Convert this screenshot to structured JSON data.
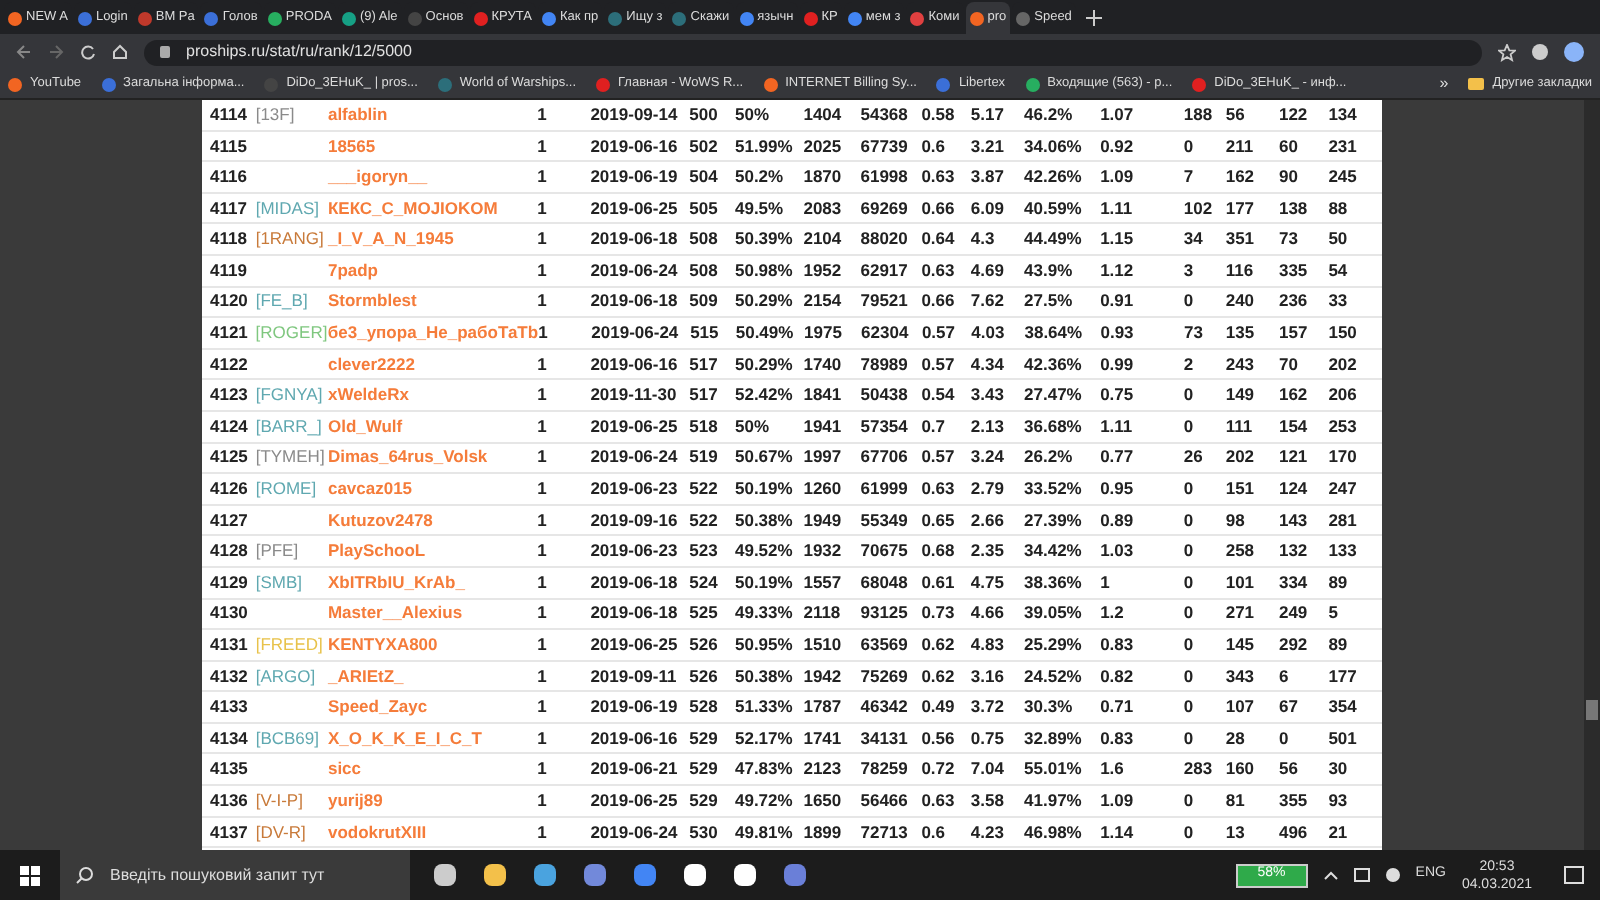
{
  "tabs": [
    {
      "title": "NEW A",
      "selected": false
    },
    {
      "title": "Login",
      "selected": false
    },
    {
      "title": "BM Pa",
      "selected": false
    },
    {
      "title": "Голов",
      "selected": false
    },
    {
      "title": "PRODA",
      "selected": false
    },
    {
      "title": "(9) Ale",
      "selected": false
    },
    {
      "title": "Основ",
      "selected": false
    },
    {
      "title": "КРУТА",
      "selected": false
    },
    {
      "title": "Как пр",
      "selected": false
    },
    {
      "title": "Ищу з",
      "selected": false
    },
    {
      "title": "Скажи",
      "selected": false
    },
    {
      "title": "язычн",
      "selected": false
    },
    {
      "title": "КР",
      "selected": false
    },
    {
      "title": "мем з",
      "selected": false
    },
    {
      "title": "Коми",
      "selected": false
    },
    {
      "title": "pro",
      "selected": true
    },
    {
      "title": "Speed",
      "selected": false
    }
  ],
  "address_bar": {
    "url": "proships.ru/stat/ru/rank/12/5000"
  },
  "bookmarks": [
    "YouTube",
    "Загальна інформа...",
    "DiDo_3EHuK_ | pros...",
    "World of Warships...",
    "Главная - WoWS R...",
    "INTERNET Billing Sy...",
    "Libertex",
    "Входящие (563) - p...",
    "DiDo_3EHuK_ - инф..."
  ],
  "bookmarks_overflow": "»",
  "other_bookmarks": "Другие закладки",
  "table": {
    "rows": [
      {
        "rank": "4114",
        "clan": "[13F]",
        "color": "#8a8a8a",
        "name": "alfablin",
        "cells": [
          "1",
          "2019-09-14",
          "500",
          "50%",
          "1404",
          "54368",
          "0.58",
          "5.17",
          "46.2%",
          "1.07",
          "188",
          "56",
          "122",
          "134"
        ]
      },
      {
        "rank": "4115",
        "name": "18565",
        "cells": [
          "1",
          "2019-06-16",
          "502",
          "51.99%",
          "2025",
          "67739",
          "0.6",
          "3.21",
          "34.06%",
          "0.92",
          "0",
          "211",
          "60",
          "231"
        ]
      },
      {
        "rank": "4116",
        "name": "___igoryn__",
        "cells": [
          "1",
          "2019-06-19",
          "504",
          "50.2%",
          "1870",
          "61998",
          "0.63",
          "3.87",
          "42.26%",
          "1.09",
          "7",
          "162",
          "90",
          "245"
        ]
      },
      {
        "rank": "4117",
        "clan": "[MIDAS]",
        "color": "#5fa8b0",
        "name": "КЕКС_С_MOJIOKOM",
        "cells": [
          "1",
          "2019-06-25",
          "505",
          "49.5%",
          "2083",
          "69269",
          "0.66",
          "6.09",
          "40.59%",
          "1.11",
          "102",
          "177",
          "138",
          "88"
        ]
      },
      {
        "rank": "4118",
        "clan": "[1RANG]",
        "color": "#c87a3a",
        "name": "_I_V_A_N_1945",
        "cells": [
          "1",
          "2019-06-18",
          "508",
          "50.39%",
          "2104",
          "88020",
          "0.64",
          "4.3",
          "44.49%",
          "1.15",
          "34",
          "351",
          "73",
          "50"
        ]
      },
      {
        "rank": "4119",
        "name": "7padp",
        "cells": [
          "1",
          "2019-06-24",
          "508",
          "50.98%",
          "1952",
          "62917",
          "0.63",
          "4.69",
          "43.9%",
          "1.12",
          "3",
          "116",
          "335",
          "54"
        ]
      },
      {
        "rank": "4120",
        "clan": "[FE_B]",
        "color": "#5fa8b0",
        "name": "Stormblest",
        "cells": [
          "1",
          "2019-06-18",
          "509",
          "50.29%",
          "2154",
          "79521",
          "0.66",
          "7.62",
          "27.5%",
          "0.91",
          "0",
          "240",
          "236",
          "33"
        ]
      },
      {
        "rank": "4121",
        "clan": "[ROGER]",
        "color": "#7fc77f",
        "name": "бе3_упора_Не_рабоТаТb",
        "cells": [
          "1",
          "2019-06-24",
          "515",
          "50.49%",
          "1975",
          "62304",
          "0.57",
          "4.03",
          "38.64%",
          "0.93",
          "73",
          "135",
          "157",
          "150"
        ]
      },
      {
        "rank": "4122",
        "name": "clever2222",
        "cells": [
          "1",
          "2019-06-16",
          "517",
          "50.29%",
          "1740",
          "78989",
          "0.57",
          "4.34",
          "42.36%",
          "0.99",
          "2",
          "243",
          "70",
          "202"
        ]
      },
      {
        "rank": "4123",
        "clan": "[FGNYA]",
        "color": "#5fa8b0",
        "name": "xWeldeRx",
        "cells": [
          "1",
          "2019-11-30",
          "517",
          "52.42%",
          "1841",
          "50438",
          "0.54",
          "3.43",
          "27.47%",
          "0.75",
          "0",
          "149",
          "162",
          "206"
        ]
      },
      {
        "rank": "4124",
        "clan": "[BARR_]",
        "color": "#5fa8b0",
        "name": "Old_Wulf",
        "cells": [
          "1",
          "2019-06-25",
          "518",
          "50%",
          "1941",
          "57354",
          "0.7",
          "2.13",
          "36.68%",
          "1.11",
          "0",
          "111",
          "154",
          "253"
        ]
      },
      {
        "rank": "4125",
        "clan": "[TYMEH]",
        "color": "#8a8a8a",
        "name": "Dimas_64rus_Volsk",
        "cells": [
          "1",
          "2019-06-24",
          "519",
          "50.67%",
          "1997",
          "67706",
          "0.57",
          "3.24",
          "26.2%",
          "0.77",
          "26",
          "202",
          "121",
          "170"
        ]
      },
      {
        "rank": "4126",
        "clan": "[ROME]",
        "color": "#5fa8b0",
        "name": "cavcaz015",
        "cells": [
          "1",
          "2019-06-23",
          "522",
          "50.19%",
          "1260",
          "61999",
          "0.63",
          "2.79",
          "33.52%",
          "0.95",
          "0",
          "151",
          "124",
          "247"
        ]
      },
      {
        "rank": "4127",
        "name": "Kutuzov2478",
        "cells": [
          "1",
          "2019-09-16",
          "522",
          "50.38%",
          "1949",
          "55349",
          "0.65",
          "2.66",
          "27.39%",
          "0.89",
          "0",
          "98",
          "143",
          "281"
        ]
      },
      {
        "rank": "4128",
        "clan": "[PFE]",
        "color": "#8a8a8a",
        "name": "PlaySchooL",
        "cells": [
          "1",
          "2019-06-23",
          "523",
          "49.52%",
          "1932",
          "70675",
          "0.68",
          "2.35",
          "34.42%",
          "1.03",
          "0",
          "258",
          "132",
          "133"
        ]
      },
      {
        "rank": "4129",
        "clan": "[SMB]",
        "color": "#5fa8b0",
        "name": "XbITRbIU_KrAb_",
        "cells": [
          "1",
          "2019-06-18",
          "524",
          "50.19%",
          "1557",
          "68048",
          "0.61",
          "4.75",
          "38.36%",
          "1",
          "0",
          "101",
          "334",
          "89"
        ]
      },
      {
        "rank": "4130",
        "name": "Master__Alexius",
        "cells": [
          "1",
          "2019-06-18",
          "525",
          "49.33%",
          "2118",
          "93125",
          "0.73",
          "4.66",
          "39.05%",
          "1.2",
          "0",
          "271",
          "249",
          "5"
        ]
      },
      {
        "rank": "4131",
        "clan": "[FREED]",
        "color": "#e8c24a",
        "name": "KENTYXA800",
        "cells": [
          "1",
          "2019-06-25",
          "526",
          "50.95%",
          "1510",
          "63569",
          "0.62",
          "4.83",
          "25.29%",
          "0.83",
          "0",
          "145",
          "292",
          "89"
        ]
      },
      {
        "rank": "4132",
        "clan": "[ARGO]",
        "color": "#5fa8b0",
        "name": "_ARIEtZ_",
        "cells": [
          "1",
          "2019-09-11",
          "526",
          "50.38%",
          "1942",
          "75269",
          "0.62",
          "3.16",
          "24.52%",
          "0.82",
          "0",
          "343",
          "6",
          "177"
        ]
      },
      {
        "rank": "4133",
        "name": "Speed_Zayc",
        "cells": [
          "1",
          "2019-06-19",
          "528",
          "51.33%",
          "1787",
          "46342",
          "0.49",
          "3.72",
          "30.3%",
          "0.71",
          "0",
          "107",
          "67",
          "354"
        ]
      },
      {
        "rank": "4134",
        "clan": "[BCB69]",
        "color": "#5fa8b0",
        "name": "X_O_K_K_E_I_C_T",
        "cells": [
          "1",
          "2019-06-16",
          "529",
          "52.17%",
          "1741",
          "34131",
          "0.56",
          "0.75",
          "32.89%",
          "0.83",
          "0",
          "28",
          "0",
          "501"
        ]
      },
      {
        "rank": "4135",
        "name": "sicc",
        "cells": [
          "1",
          "2019-06-21",
          "529",
          "47.83%",
          "2123",
          "78259",
          "0.72",
          "7.04",
          "55.01%",
          "1.6",
          "283",
          "160",
          "56",
          "30"
        ]
      },
      {
        "rank": "4136",
        "clan": "[V-I-P]",
        "color": "#c87a3a",
        "name": "yurij89",
        "cells": [
          "1",
          "2019-06-25",
          "529",
          "49.72%",
          "1650",
          "56466",
          "0.63",
          "3.58",
          "41.97%",
          "1.09",
          "0",
          "81",
          "355",
          "93"
        ]
      },
      {
        "rank": "4137",
        "clan": "[DV-R]",
        "color": "#c87a3a",
        "name": "vodokrutXIII",
        "cells": [
          "1",
          "2019-06-24",
          "530",
          "49.81%",
          "1899",
          "72713",
          "0.6",
          "4.23",
          "46.98%",
          "1.14",
          "0",
          "13",
          "496",
          "21"
        ]
      }
    ]
  },
  "taskbar": {
    "search_placeholder": "Введіть пошуковий запит тут",
    "battery": "58%",
    "language": "ENG",
    "time": "20:53",
    "date": "04.03.2021"
  }
}
